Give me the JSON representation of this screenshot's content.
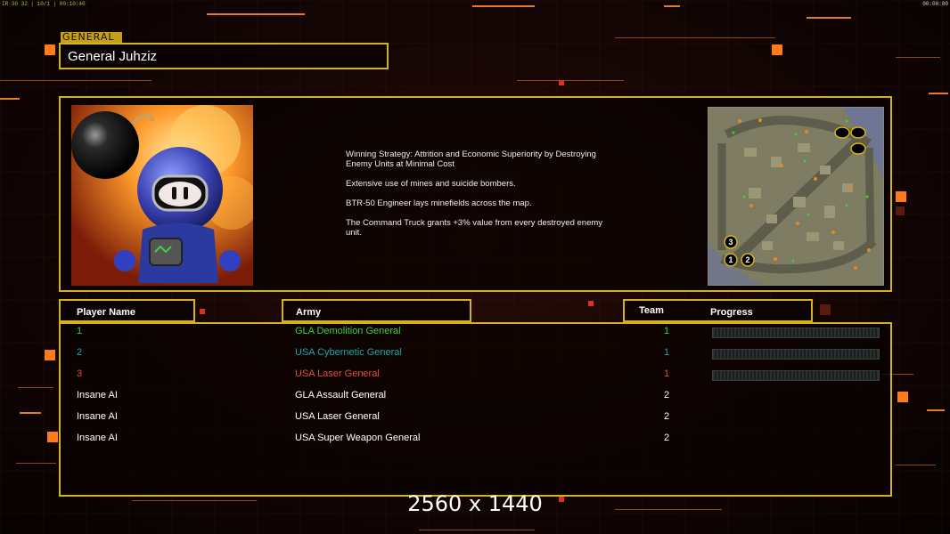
{
  "status": {
    "fps_left": "IR 30 32 | 10/1 | 00:10:40",
    "clock_right": "00:00:00"
  },
  "general": {
    "tag": "GENERAL",
    "name": "General Juhziz"
  },
  "strategy": {
    "lines": [
      "Winning Strategy: Attrition and Economic Superiority by Destroying\n Enemy Units at Minimal Cost",
      "Extensive use of mines and suicide bombers.",
      "BTR-50 Engineer lays minefields across the map.",
      "The Command Truck grants +3% value from every destroyed enemy\n unit."
    ]
  },
  "minimap": {
    "start_markers": [
      "1",
      "2",
      "3"
    ]
  },
  "table": {
    "headers": {
      "player": "Player Name",
      "army": "Army",
      "team": "Team",
      "progress": "Progress"
    },
    "rows": [
      {
        "name": "1",
        "army": "GLA Demolition General",
        "team": "1",
        "color": "#3dd23d",
        "has_progress": true
      },
      {
        "name": "2",
        "army": "USA Cybernetic General",
        "team": "1",
        "color": "#1fa6a6",
        "has_progress": true
      },
      {
        "name": "3",
        "army": "USA Laser General",
        "team": "1",
        "color": "#e0503c",
        "has_progress": true
      },
      {
        "name": "Insane AI",
        "army": "GLA Assault General",
        "team": "2",
        "color": "#ffffff",
        "has_progress": false
      },
      {
        "name": "Insane AI",
        "army": "USA Laser General",
        "team": "2",
        "color": "#ffffff",
        "has_progress": false
      },
      {
        "name": "Insane AI",
        "army": "USA Super Weapon General",
        "team": "2",
        "color": "#ffffff",
        "has_progress": false
      }
    ]
  },
  "overlay": {
    "resolution": "2560 x 1440"
  },
  "colors": {
    "accent_gold": "#d4b21c",
    "accent_orange": "#ff7a1a"
  }
}
